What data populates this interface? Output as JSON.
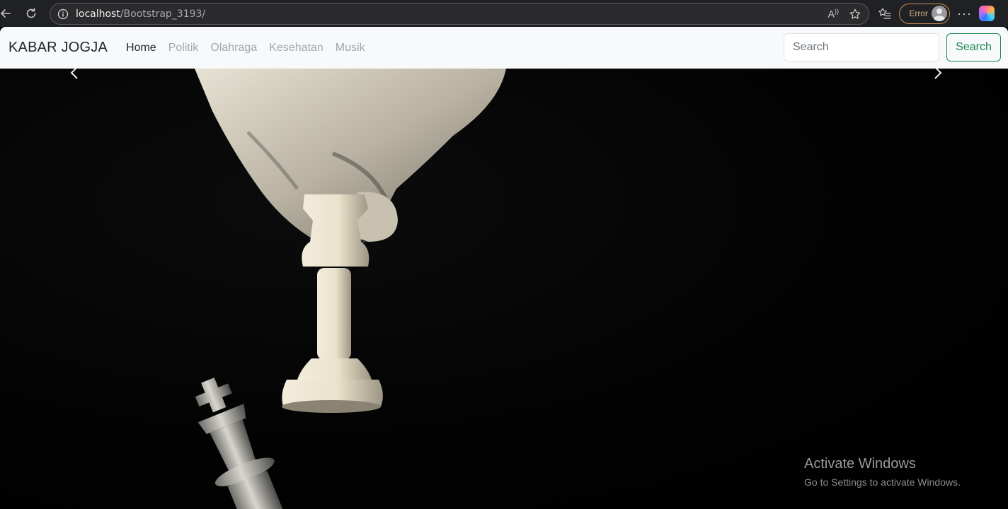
{
  "browser": {
    "url_host": "localhost",
    "url_path": "/Bootstrap_3193/",
    "profile_status": "Error",
    "read_aloud_label": "A"
  },
  "navbar": {
    "brand": "KABAR JOGJA",
    "links": [
      {
        "label": "Home",
        "active": true
      },
      {
        "label": "Politik",
        "active": false
      },
      {
        "label": "Olahraga",
        "active": false
      },
      {
        "label": "Kesehatan",
        "active": false
      },
      {
        "label": "Musik",
        "active": false
      }
    ],
    "search_placeholder": "Search",
    "search_button": "Search"
  },
  "carousel": {
    "image": "chess-hand-king-toppling",
    "prev_icon": "chevron-left-icon",
    "next_icon": "chevron-right-icon"
  },
  "watermark": {
    "title": "Activate Windows",
    "subtitle": "Go to Settings to activate Windows."
  },
  "colors": {
    "accent_success": "#198754",
    "navbar_bg": "#f8f9fa",
    "muted_link": "#a3a6aa"
  }
}
